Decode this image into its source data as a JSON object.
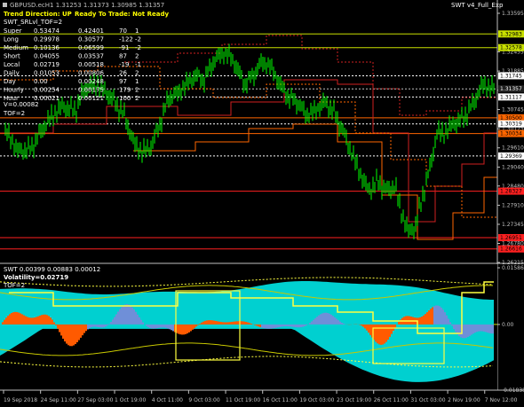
{
  "window": {
    "symbol_line": "GBPUSD.ecH1  1.31253 1.31373 1.30985 1.31357",
    "indicator_name": "SWT v4_Full_Exp",
    "trend_label": "Trend Direction:  UP",
    "ready_label": "Ready To Trade:  Not Ready",
    "main_sub_label": "SWT_SRLvl_TOF=2"
  },
  "stats_table": [
    {
      "name": "Super",
      "v1": "0.53474",
      "v2": "0.42401",
      "v3": "70",
      "v4": "1"
    },
    {
      "name": "Long",
      "v1": "0.29978",
      "v2": "0.30577",
      "v3": "-122",
      "v4": "-2"
    },
    {
      "name": "Medium",
      "v1": "0.10136",
      "v2": "0.06599",
      "v3": "-91",
      "v4": "-2"
    },
    {
      "name": "Short",
      "v1": "0.04055",
      "v2": "0.03537",
      "v3": "87",
      "v4": "2"
    },
    {
      "name": "Local",
      "v1": "0.02719",
      "v2": "0.00518",
      "v3": "-19",
      "v4": "-1"
    },
    {
      "name": "Daily",
      "v1": "0.01053",
      "v2": "0.00806",
      "v3": "26",
      "v4": "2"
    },
    {
      "name": "Day",
      "v1": "0.00",
      "v2": "0.00248",
      "v3": "97",
      "v4": "1"
    },
    {
      "name": "Hourly",
      "v1": "0.00254",
      "v2": "0.00175",
      "v3": "179",
      "v4": "2"
    },
    {
      "name": "Hour",
      "v1": "0.00021",
      "v2": "0.00121",
      "v3": "100",
      "v4": "2"
    }
  ],
  "extra_labels": [
    "V=0.00082",
    "TOF=2"
  ],
  "price_axis": {
    "ticks": [
      "1.33595",
      "1.32455",
      "1.31885",
      "1.31315",
      "1.30745",
      "1.30175",
      "1.29610",
      "1.29040",
      "1.28480",
      "1.27910",
      "1.27345",
      "1.26780",
      "1.26215"
    ],
    "levels": [
      {
        "value": "1.32983",
        "color": "#c8e000"
      },
      {
        "value": "1.32578",
        "color": "#c8e000"
      },
      {
        "value": "1.31745",
        "color": "#ffffff"
      },
      {
        "value": "1.31357",
        "color": "#c0c0c0"
      },
      {
        "value": "1.31117",
        "color": "#ffffff"
      },
      {
        "value": "1.30500",
        "color": "#ff6600"
      },
      {
        "value": "1.30319",
        "color": "#ffffff"
      },
      {
        "value": "1.30034",
        "color": "#ff6600"
      },
      {
        "value": "1.29369",
        "color": "#ffffff"
      },
      {
        "value": "1.28327",
        "color": "#ff2020"
      },
      {
        "value": "1.26951",
        "color": "#ff2020"
      },
      {
        "value": "1.26616",
        "color": "#ff2020"
      }
    ]
  },
  "sub_window": {
    "title": "SWT 0.00399 0.00883 0.00012",
    "volatility": "Volatility=0.02719",
    "tof": "TOF=2",
    "ticks": [
      "0.01586",
      "0.00",
      "-0.01838"
    ]
  },
  "time_axis": [
    "19 Sep 2018",
    "24 Sep 11:00",
    "27 Sep 03:00",
    "1 Oct 19:00",
    "4 Oct 11:00",
    "9 Oct 03:00",
    "11 Oct 19:00",
    "16 Oct 11:00",
    "19 Oct 03:00",
    "23 Oct 19:00",
    "26 Oct 11:00",
    "31 Oct 03:00",
    "2 Nov 19:00",
    "7 Nov 12:00"
  ],
  "colors": {
    "candle": "#00ff00",
    "cyan": "#00d0d0",
    "orange": "#ff5a00",
    "blue": "#6f8fd8",
    "yellow": "#ffff40",
    "red_level": "#d02020",
    "olive_line": "#c8e000"
  }
}
